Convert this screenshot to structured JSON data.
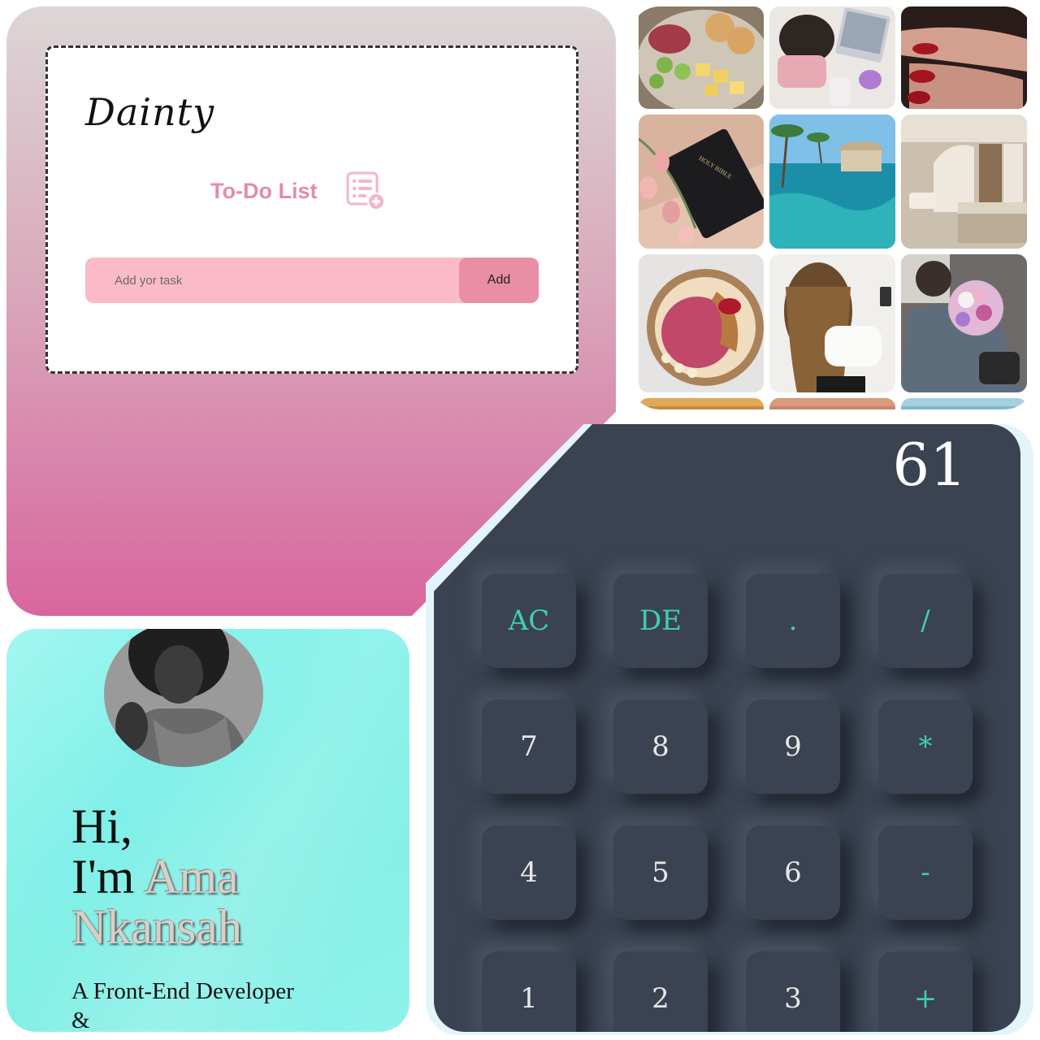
{
  "todo": {
    "brand": "Dainty",
    "title": "To-Do List",
    "input_placeholder": "Add yor task",
    "add_label": "Add"
  },
  "gallery": {
    "items": [
      {
        "name": "food-platter"
      },
      {
        "name": "laptop-desk"
      },
      {
        "name": "red-nails"
      },
      {
        "name": "bible-tulips",
        "caption": "HOLY BIBLE"
      },
      {
        "name": "resort-pool"
      },
      {
        "name": "bedroom-interior"
      },
      {
        "name": "smoothie-bowl"
      },
      {
        "name": "curly-hair-selfie"
      },
      {
        "name": "man-with-flowers"
      }
    ]
  },
  "calculator": {
    "display": "61",
    "keys": [
      [
        "AC",
        "DE",
        ".",
        "/"
      ],
      [
        "7",
        "8",
        "9",
        "*"
      ],
      [
        "4",
        "5",
        "6",
        "-"
      ],
      [
        "1",
        "2",
        "3",
        "+"
      ]
    ],
    "colors": {
      "panel": "#3b4352",
      "accent": "#3ecfb6"
    }
  },
  "profile": {
    "greeting_line1": "Hi,",
    "greeting_line2": "I'm",
    "first_name": "Ama",
    "last_name": "Nkansah",
    "role_line1": "A Front-End Developer",
    "role_line2": "&"
  }
}
